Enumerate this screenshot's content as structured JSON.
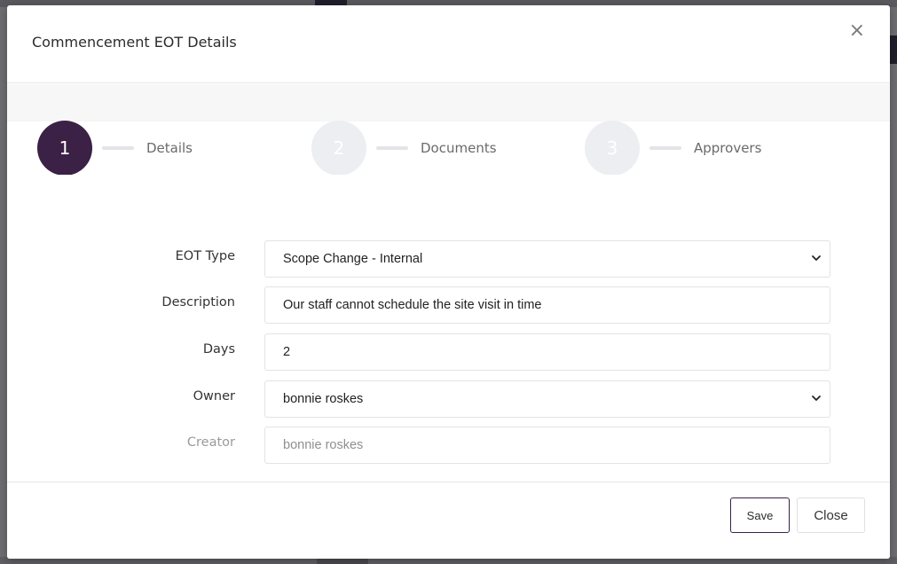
{
  "modal": {
    "title": "Commencement EOT Details",
    "close_symbol": "×"
  },
  "stepper": {
    "steps": [
      {
        "number": "1",
        "label": "Details",
        "state": "active"
      },
      {
        "number": "2",
        "label": "Documents",
        "state": "inactive"
      },
      {
        "number": "3",
        "label": "Approvers",
        "state": "inactive"
      }
    ]
  },
  "form": {
    "eot_type": {
      "label": "EOT Type",
      "value": "Scope Change - Internal"
    },
    "description": {
      "label": "Description",
      "value": "Our staff cannot schedule the site visit in time"
    },
    "days": {
      "label": "Days",
      "value": "2"
    },
    "owner": {
      "label": "Owner",
      "value": "bonnie roskes"
    },
    "creator": {
      "label": "Creator",
      "value": "bonnie roskes"
    }
  },
  "footer": {
    "save_label": "Save",
    "close_label": "Close"
  },
  "colors": {
    "accent": "#3b2145",
    "step_inactive": "#eceef2"
  }
}
